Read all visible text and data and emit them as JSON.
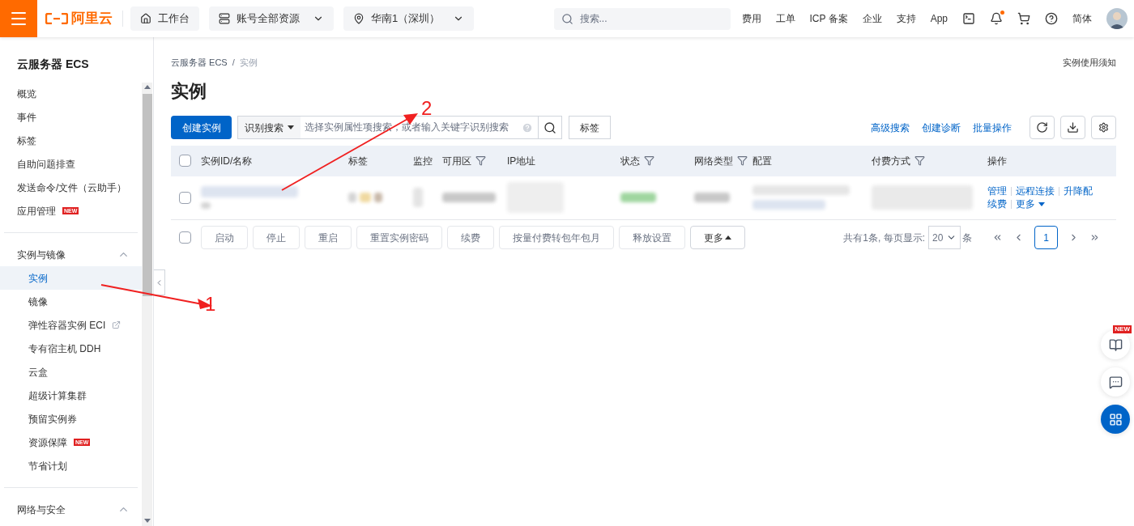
{
  "header": {
    "logo_text": "阿里云",
    "nav": [
      {
        "kind": "home",
        "label": "工作台"
      },
      {
        "kind": "resources",
        "label": "账号全部资源"
      },
      {
        "kind": "region",
        "label": "华南1（深圳）"
      }
    ],
    "search": {
      "placeholder": "搜索..."
    },
    "links": [
      "费用",
      "工单",
      "ICP 备案",
      "企业",
      "支持",
      "App"
    ],
    "notification_dot": true,
    "language": "简体"
  },
  "sidebar": {
    "title": "云服务器 ECS",
    "sections": [
      {
        "items": [
          {
            "label": "概览",
            "selected": false
          },
          {
            "label": "事件",
            "selected": false
          },
          {
            "label": "标签",
            "selected": false
          },
          {
            "label": "自助问题排查",
            "selected": false
          },
          {
            "label": "发送命令/文件（云助手）",
            "selected": false
          },
          {
            "label": "应用管理",
            "selected": false,
            "badge": "NEW"
          }
        ]
      },
      {
        "label": "实例与镜像",
        "expanded": true,
        "items": [
          {
            "label": "实例",
            "selected": true
          },
          {
            "label": "镜像",
            "selected": false
          },
          {
            "label": "弹性容器实例 ECI",
            "selected": false,
            "external": true
          },
          {
            "label": "专有宿主机 DDH",
            "selected": false
          },
          {
            "label": "云盒",
            "selected": false
          },
          {
            "label": "超级计算集群",
            "selected": false
          },
          {
            "label": "预留实例券",
            "selected": false
          },
          {
            "label": "资源保障",
            "selected": false,
            "badge": "NEW"
          },
          {
            "label": "节省计划",
            "selected": false
          }
        ]
      },
      {
        "label": "网络与安全",
        "expanded": true
      }
    ]
  },
  "main": {
    "breadcrumb": [
      "云服务器 ECS",
      "实例"
    ],
    "breadcrumb_separator": "/",
    "notice_link": "实例使用须知",
    "title": "实例",
    "create_button": "创建实例",
    "search": {
      "mode": "识别搜索",
      "placeholder": "选择实例属性项搜索，或者输入关键字识别搜索"
    },
    "tag_button": "标签",
    "links": [
      "高级搜索",
      "创建诊断",
      "批量操作"
    ],
    "table": {
      "select_all": {
        "checked": false
      },
      "columns": [
        {
          "label": "实例ID/名称",
          "filter": false
        },
        {
          "label": "标签",
          "filter": false
        },
        {
          "label": "监控",
          "filter": false
        },
        {
          "label": "可用区",
          "filter": true
        },
        {
          "label": "IP地址",
          "filter": false
        },
        {
          "label": "状态",
          "filter": true
        },
        {
          "label": "网络类型",
          "filter": true
        },
        {
          "label": "配置",
          "filter": false
        },
        {
          "label": "付费方式",
          "filter": true
        },
        {
          "label": "操作",
          "filter": false
        }
      ],
      "rows": [
        {
          "checked": false,
          "actions": [
            [
              "管理",
              "远程连接",
              "升降配"
            ],
            [
              "续费",
              "更多"
            ]
          ]
        }
      ]
    },
    "batch": {
      "checked": false,
      "buttons": [
        {
          "label": "启动",
          "disabled": true
        },
        {
          "label": "停止",
          "disabled": true
        },
        {
          "label": "重启",
          "disabled": true
        },
        {
          "label": "重置实例密码",
          "disabled": true
        },
        {
          "label": "续费",
          "disabled": true
        },
        {
          "label": "按量付费转包年包月",
          "disabled": true
        },
        {
          "label": "释放设置",
          "disabled": true
        },
        {
          "label": "更多",
          "disabled": false
        }
      ]
    },
    "pagination": {
      "summary": "共有1条, 每页显示:",
      "page_size": "20",
      "unit": "条",
      "pages": [
        {
          "label": "1",
          "selected": true
        }
      ]
    }
  },
  "floating": [
    {
      "kind": "guide",
      "badge": "NEW"
    },
    {
      "kind": "chat"
    },
    {
      "kind": "apps"
    }
  ],
  "annotations": [
    {
      "label": "1"
    },
    {
      "label": "2"
    }
  ]
}
